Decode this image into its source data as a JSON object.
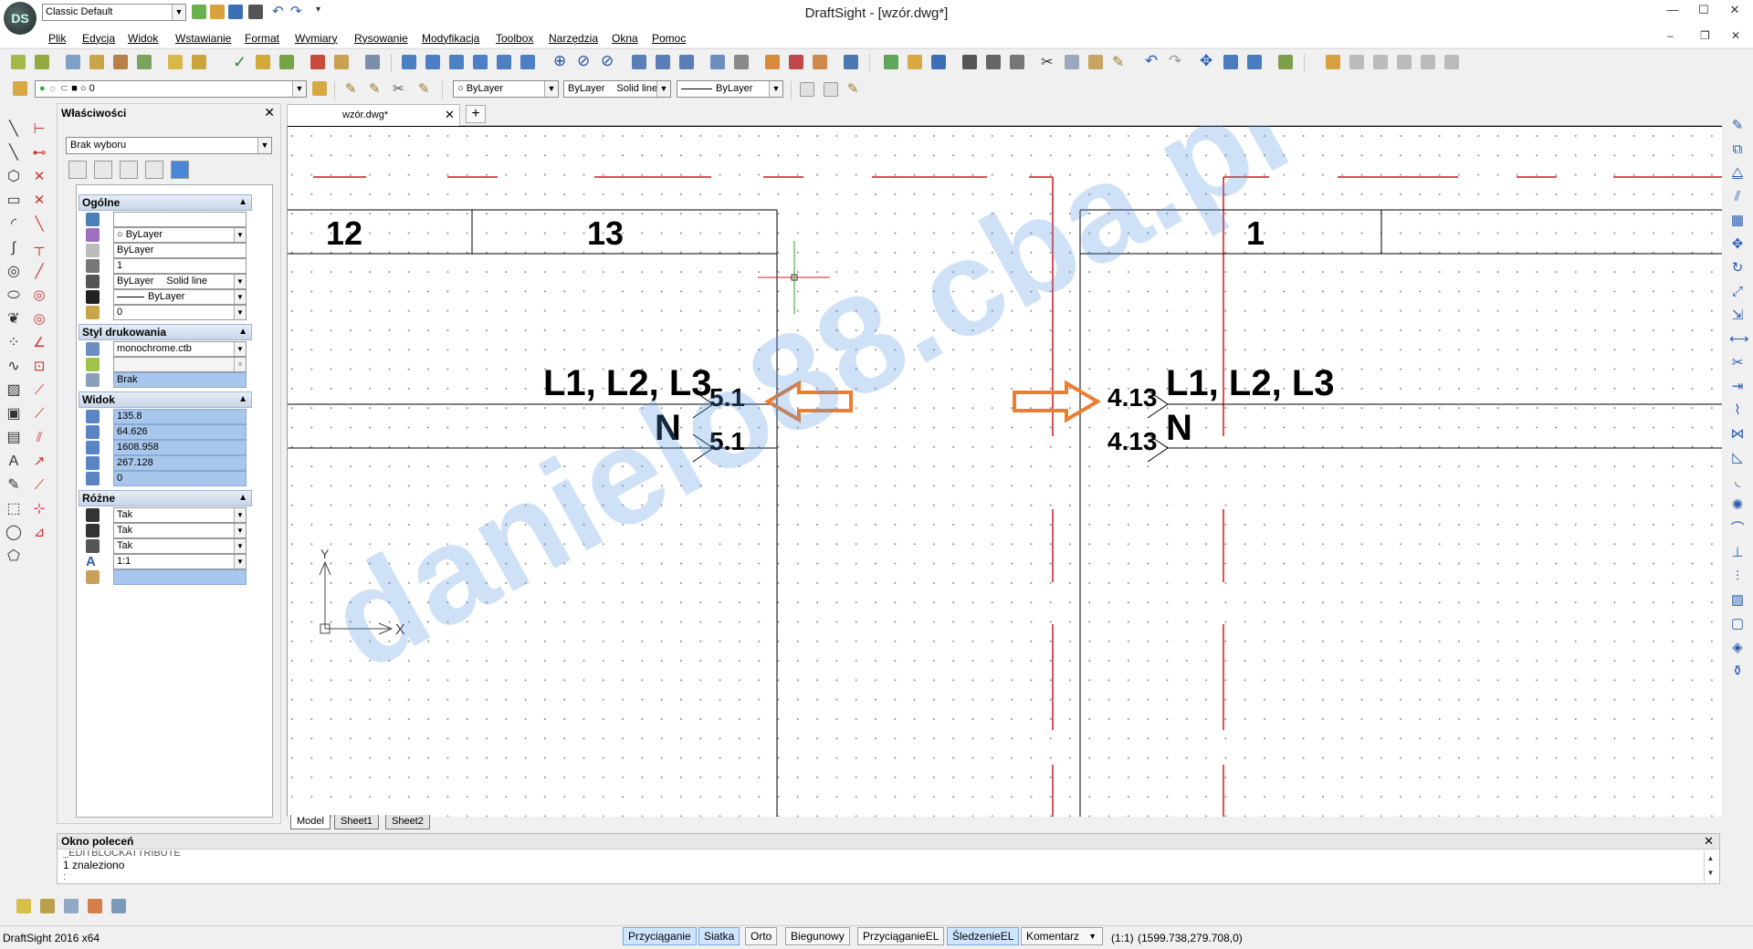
{
  "window": {
    "title": "DraftSight - [wzór.dwg*]",
    "workspace": "Classic Default",
    "logo": "DS"
  },
  "menu": [
    "Plik",
    "Edycja",
    "Widok",
    "Wstawianie",
    "Format",
    "Wymiary",
    "Rysowanie",
    "Modyfikacja",
    "Toolbox",
    "Narzędzia",
    "Okna",
    "Pomoc"
  ],
  "layer_bar": {
    "current_layer": "0",
    "color": "ByLayer",
    "linestyle_name": "ByLayer",
    "linestyle_type": "Solid line",
    "lineweight": "ByLayer"
  },
  "properties": {
    "title": "Właściwości",
    "selection": "Brak wyboru",
    "sections": {
      "general": {
        "label": "Ogólne",
        "color": "ByLayer",
        "linestyle": "ByLayer",
        "linescale": "1",
        "lineweight_name": "ByLayer",
        "lineweight_type": "Solid line",
        "lineweight": "ByLayer",
        "layer": "0"
      },
      "print_style": {
        "label": "Styl drukowania",
        "table": "monochrome.ctb",
        "style": "Brak"
      },
      "view": {
        "label": "Widok",
        "values": [
          "135.8",
          "64.626",
          "1608.958",
          "267.128",
          "0"
        ]
      },
      "misc": {
        "label": "Różne",
        "values": [
          "Tak",
          "Tak",
          "Tak",
          "1:1"
        ]
      }
    }
  },
  "document_tab": "wzór.dwg*",
  "sheet_tabs": [
    "Model",
    "Sheet1",
    "Sheet2"
  ],
  "drawing": {
    "watermark": "danielo88.cba.pl",
    "left_numbers": [
      "12",
      "13"
    ],
    "right_number": "1",
    "left_phases": "L1, L2, L3",
    "left_neutral": "N",
    "left_refs": [
      "5.1",
      "5.1"
    ],
    "right_phases": "L1, L2, L3",
    "right_neutral": "N",
    "right_refs": [
      "4.13",
      "4.13"
    ],
    "axis_x": "X",
    "axis_y": "Y",
    "accent": "#ed7d31"
  },
  "command_window": {
    "title": "Okno poleceń",
    "line1": "_EDITBLOCKATTRIBUTE",
    "line2": "1 znaleziono",
    "prompt": ":"
  },
  "statusbar": {
    "app": "DraftSight 2016 x64",
    "buttons": [
      {
        "label": "Przyciąganie",
        "on": true
      },
      {
        "label": "Siatka",
        "on": true
      },
      {
        "label": "Orto",
        "on": false
      },
      {
        "label": "Biegunowy",
        "on": false
      },
      {
        "label": "PrzyciąganieEL",
        "on": false
      },
      {
        "label": "ŚledzenieEL",
        "on": true
      }
    ],
    "annotation": "Komentarz",
    "scale": "(1:1)",
    "coords": "(1599.738,279.708,0)"
  }
}
